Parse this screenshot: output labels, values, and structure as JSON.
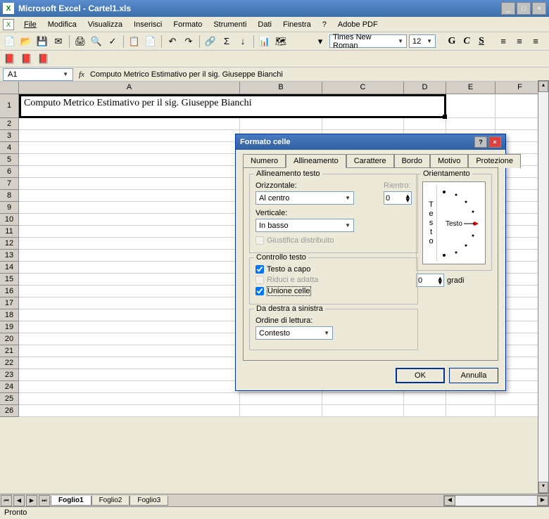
{
  "app": {
    "title": "Microsoft Excel - Cartel1.xls"
  },
  "menu": [
    "File",
    "Modifica",
    "Visualizza",
    "Inserisci",
    "Formato",
    "Strumenti",
    "Dati",
    "Finestra",
    "?",
    "Adobe PDF"
  ],
  "toolbar": {
    "font": "Times New Roman",
    "size": "12",
    "bold": "G",
    "italic": "C",
    "underline": "S"
  },
  "namebox": "A1",
  "fx": "fx",
  "formula": "Computo Metrico Estimativo per il sig. Giuseppe Bianchi",
  "cols": [
    "A",
    "B",
    "C",
    "D",
    "E",
    "F"
  ],
  "cellA1": "Computo Metrico Estimativo per il sig. Giuseppe Bianchi",
  "sheets": [
    "Foglio1",
    "Foglio2",
    "Foglio3"
  ],
  "status": "Pronto",
  "dialog": {
    "title": "Formato celle",
    "tabs": [
      "Numero",
      "Allineamento",
      "Carattere",
      "Bordo",
      "Motivo",
      "Protezione"
    ],
    "group_align": "Allineamento testo",
    "lbl_horiz": "Orizzontale:",
    "val_horiz": "Al centro",
    "lbl_vert": "Verticale:",
    "val_vert": "In basso",
    "lbl_indent": "Rientro:",
    "val_indent": "0",
    "chk_justdist": "Giustifica distribuito",
    "group_ctrl": "Controllo testo",
    "chk_wrap": "Testo a capo",
    "chk_shrink": "Riduci e adatta",
    "chk_merge": "Unione celle",
    "group_rtl": "Da destra a sinistra",
    "lbl_reading": "Ordine di lettura:",
    "val_reading": "Contesto",
    "group_orient": "Orientamento",
    "orient_text": "Testo",
    "orient_vtext": "Testo",
    "orient_deg": "0",
    "orient_deglbl": "gradi",
    "ok": "OK",
    "cancel": "Annulla"
  }
}
